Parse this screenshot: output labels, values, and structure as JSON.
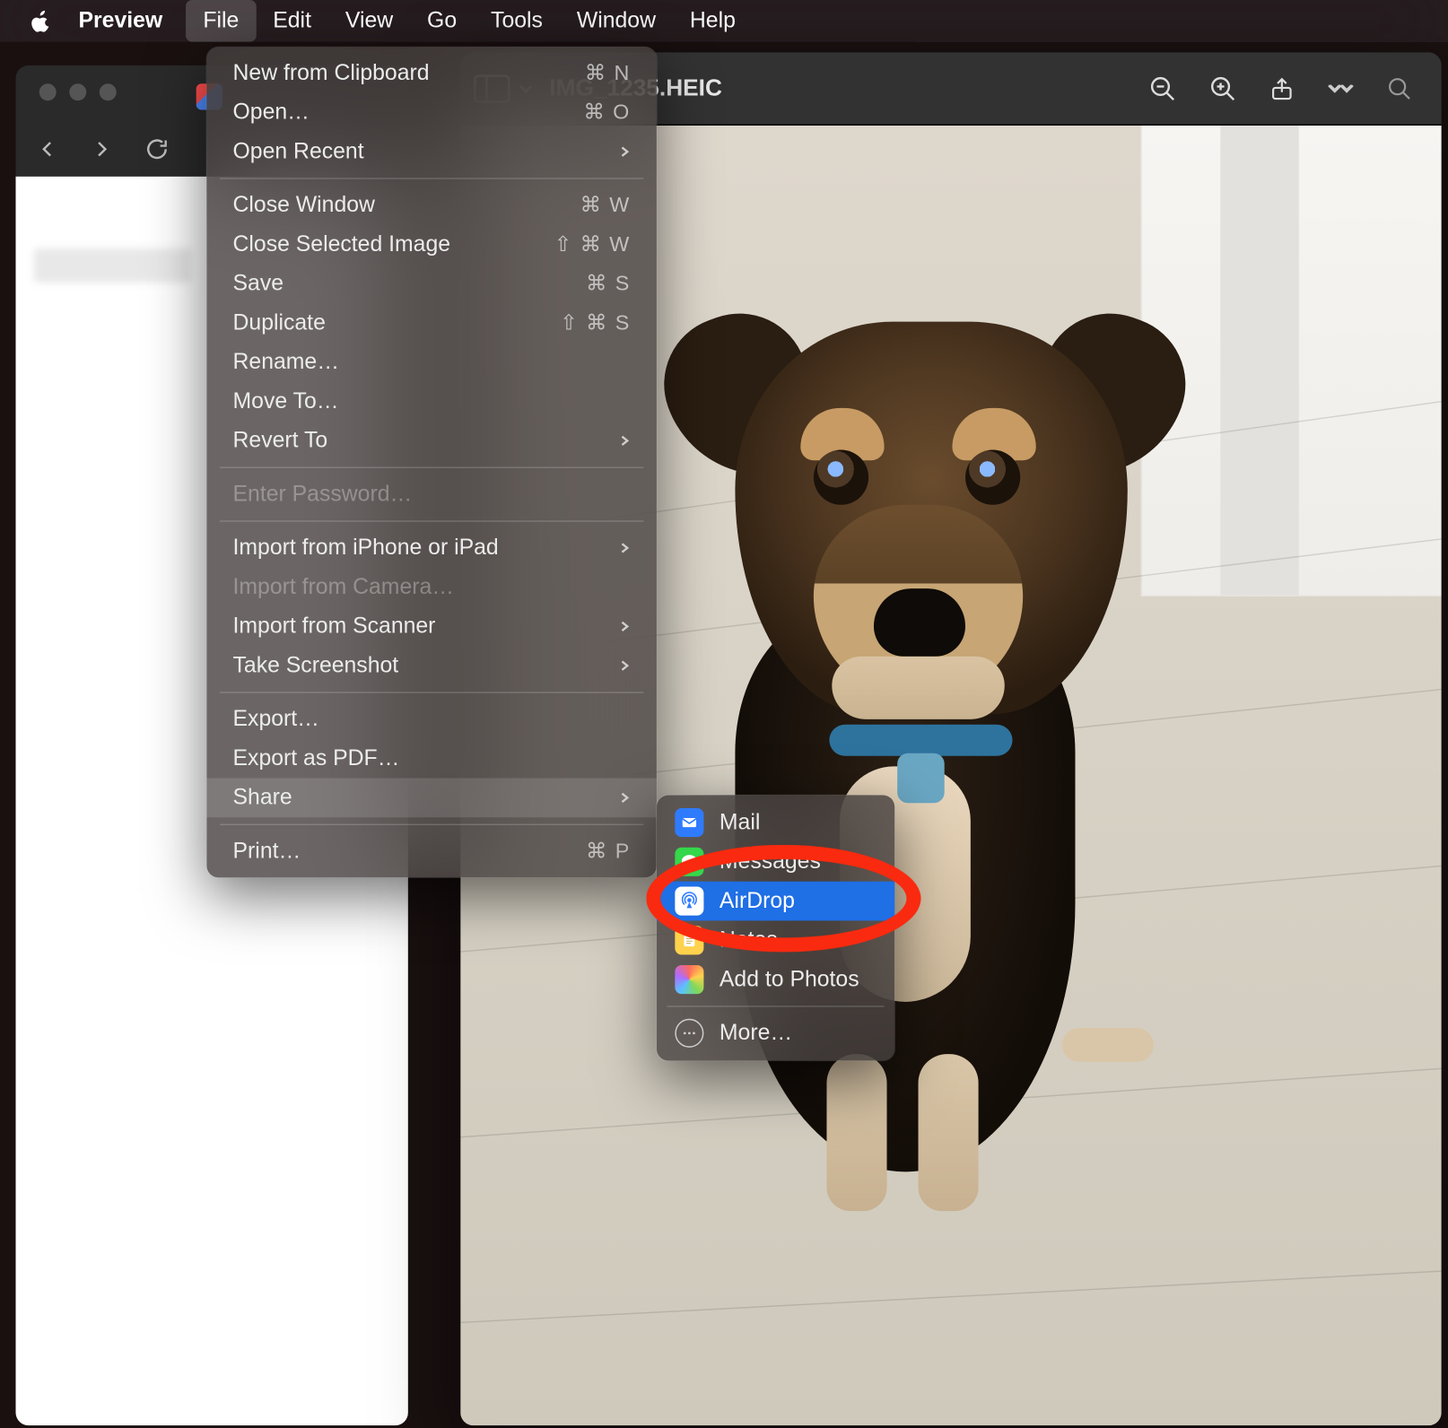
{
  "menubar": {
    "app": "Preview",
    "items": [
      "File",
      "Edit",
      "View",
      "Go",
      "Tools",
      "Window",
      "Help"
    ],
    "active_index": 0
  },
  "preview_window": {
    "title": "IMG_1235.HEIC"
  },
  "file_menu": {
    "groups": [
      [
        {
          "label": "New from Clipboard",
          "shortcut": "⌘ N"
        },
        {
          "label": "Open…",
          "shortcut": "⌘ O"
        },
        {
          "label": "Open Recent",
          "arrow": true
        }
      ],
      [
        {
          "label": "Close Window",
          "shortcut": "⌘ W"
        },
        {
          "label": "Close Selected Image",
          "shortcut": "⇧ ⌘ W"
        },
        {
          "label": "Save",
          "shortcut": "⌘ S"
        },
        {
          "label": "Duplicate",
          "shortcut": "⇧ ⌘ S"
        },
        {
          "label": "Rename…"
        },
        {
          "label": "Move To…"
        },
        {
          "label": "Revert To",
          "arrow": true
        }
      ],
      [
        {
          "label": "Enter Password…",
          "disabled": true
        }
      ],
      [
        {
          "label": "Import from iPhone or iPad",
          "arrow": true
        },
        {
          "label": "Import from Camera…",
          "disabled": true
        },
        {
          "label": "Import from Scanner",
          "arrow": true
        },
        {
          "label": "Take Screenshot",
          "arrow": true
        }
      ],
      [
        {
          "label": "Export…"
        },
        {
          "label": "Export as PDF…"
        },
        {
          "label": "Share",
          "arrow": true,
          "hover": true
        }
      ],
      [
        {
          "label": "Print…",
          "shortcut": "⌘ P"
        }
      ]
    ]
  },
  "share_menu": {
    "items": [
      {
        "icon": "mail",
        "label": "Mail"
      },
      {
        "icon": "messages",
        "label": "Messages"
      },
      {
        "icon": "airdrop",
        "label": "AirDrop",
        "highlight": true
      },
      {
        "icon": "notes",
        "label": "Notes"
      },
      {
        "icon": "photos",
        "label": "Add to Photos"
      }
    ],
    "more_label": "More…"
  }
}
